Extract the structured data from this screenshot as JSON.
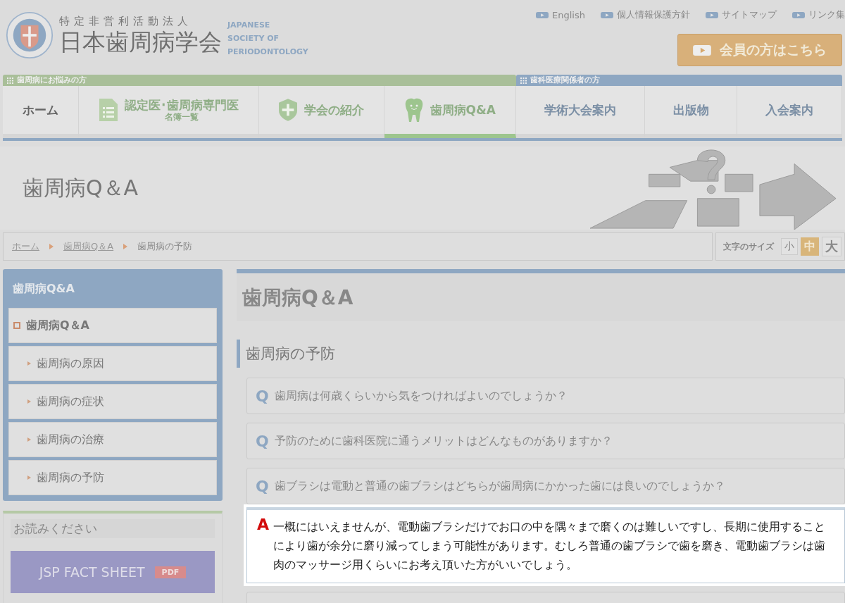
{
  "header": {
    "org_type": "特定非営利活動法人",
    "org_name": "日本歯周病学会",
    "english_name": [
      "JAPANESE",
      "SOCIETY OF",
      "PERIODONTOLOGY"
    ]
  },
  "top_links": [
    "English",
    "個人情報保護方針",
    "サイトマップ",
    "リンク集"
  ],
  "member_button": "会員の方はこちら",
  "nav": {
    "groups": [
      {
        "label": "歯周病にお悩みの方",
        "color": "#a9bf99",
        "items": [
          {
            "label": "ホーム",
            "kind": "plain",
            "selected": false
          },
          {
            "label": "認定医･歯周病専門医",
            "sub": "名簿一覧",
            "kind": "list",
            "selected": false
          },
          {
            "label": "学会の紹介",
            "kind": "shield",
            "selected": false
          },
          {
            "label": "歯周病Q&A",
            "kind": "tooth",
            "selected": true
          }
        ]
      },
      {
        "label": "歯科医療関係者の方",
        "color": "#8ea7c2",
        "items": [
          {
            "label": "学術大会案内",
            "kind": "plain",
            "selected": false
          },
          {
            "label": "出版物",
            "kind": "plain",
            "selected": false
          },
          {
            "label": "入会案内",
            "kind": "plain",
            "selected": false
          }
        ]
      }
    ]
  },
  "banner": {
    "title": "歯周病Q＆A"
  },
  "breadcrumb": [
    {
      "label": "ホーム",
      "link": true
    },
    {
      "label": "歯周病Q＆A",
      "link": true
    },
    {
      "label": "歯周病の予防",
      "link": false
    }
  ],
  "font_size": {
    "label": "文字のサイズ",
    "options": [
      {
        "label": "小",
        "selected": false
      },
      {
        "label": "中",
        "selected": true
      },
      {
        "label": "大",
        "selected": false
      }
    ]
  },
  "sidebar": {
    "title": "歯周病Q&A",
    "items": [
      {
        "label": "歯周病Q＆A",
        "children": [
          {
            "label": "歯周病の原因"
          },
          {
            "label": "歯周病の症状"
          },
          {
            "label": "歯周病の治療"
          },
          {
            "label": "歯周病の予防"
          }
        ]
      }
    ]
  },
  "notice": {
    "title": "お読みください",
    "button": "JSP FACT SHEET",
    "badge": "PDF"
  },
  "main": {
    "heading": "歯周病Q＆A",
    "section": "歯周病の予防",
    "qa": [
      {
        "mark": "Q",
        "question": "歯周病は何歳くらいから気をつければよいのでしょうか？",
        "expanded": false
      },
      {
        "mark": "Q",
        "question": "予防のために歯科医院に通うメリットはどんなものがありますか？",
        "expanded": false
      },
      {
        "mark": "Q",
        "question": "歯ブラシは電動と普通の歯ブラシはどちらが歯周病にかかった歯には良いのでしょうか？",
        "expanded": true,
        "answer_mark": "A",
        "answer": "一概にはいえませんが、電動歯ブラシだけでお口の中を隅々まで磨くのは難しいですし、長期に使用することにより歯が余分に磨り減ってしまう可能性があります。むしろ普通の歯ブラシで歯を磨き、電動歯ブラシは歯肉のマッサージ用くらいにお考え頂いた方がいいでしょう。"
      }
    ]
  }
}
